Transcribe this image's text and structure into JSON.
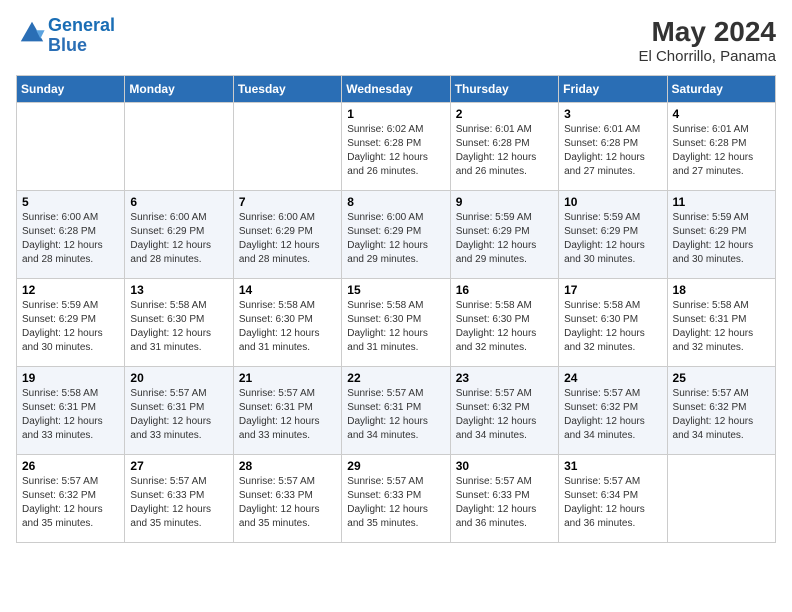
{
  "header": {
    "logo_general": "General",
    "logo_blue": "Blue",
    "month_year": "May 2024",
    "location": "El Chorrillo, Panama"
  },
  "days_of_week": [
    "Sunday",
    "Monday",
    "Tuesday",
    "Wednesday",
    "Thursday",
    "Friday",
    "Saturday"
  ],
  "weeks": [
    [
      {
        "day": "",
        "info": ""
      },
      {
        "day": "",
        "info": ""
      },
      {
        "day": "",
        "info": ""
      },
      {
        "day": "1",
        "info": "Sunrise: 6:02 AM\nSunset: 6:28 PM\nDaylight: 12 hours and 26 minutes."
      },
      {
        "day": "2",
        "info": "Sunrise: 6:01 AM\nSunset: 6:28 PM\nDaylight: 12 hours and 26 minutes."
      },
      {
        "day": "3",
        "info": "Sunrise: 6:01 AM\nSunset: 6:28 PM\nDaylight: 12 hours and 27 minutes."
      },
      {
        "day": "4",
        "info": "Sunrise: 6:01 AM\nSunset: 6:28 PM\nDaylight: 12 hours and 27 minutes."
      }
    ],
    [
      {
        "day": "5",
        "info": "Sunrise: 6:00 AM\nSunset: 6:28 PM\nDaylight: 12 hours and 28 minutes."
      },
      {
        "day": "6",
        "info": "Sunrise: 6:00 AM\nSunset: 6:29 PM\nDaylight: 12 hours and 28 minutes."
      },
      {
        "day": "7",
        "info": "Sunrise: 6:00 AM\nSunset: 6:29 PM\nDaylight: 12 hours and 28 minutes."
      },
      {
        "day": "8",
        "info": "Sunrise: 6:00 AM\nSunset: 6:29 PM\nDaylight: 12 hours and 29 minutes."
      },
      {
        "day": "9",
        "info": "Sunrise: 5:59 AM\nSunset: 6:29 PM\nDaylight: 12 hours and 29 minutes."
      },
      {
        "day": "10",
        "info": "Sunrise: 5:59 AM\nSunset: 6:29 PM\nDaylight: 12 hours and 30 minutes."
      },
      {
        "day": "11",
        "info": "Sunrise: 5:59 AM\nSunset: 6:29 PM\nDaylight: 12 hours and 30 minutes."
      }
    ],
    [
      {
        "day": "12",
        "info": "Sunrise: 5:59 AM\nSunset: 6:29 PM\nDaylight: 12 hours and 30 minutes."
      },
      {
        "day": "13",
        "info": "Sunrise: 5:58 AM\nSunset: 6:30 PM\nDaylight: 12 hours and 31 minutes."
      },
      {
        "day": "14",
        "info": "Sunrise: 5:58 AM\nSunset: 6:30 PM\nDaylight: 12 hours and 31 minutes."
      },
      {
        "day": "15",
        "info": "Sunrise: 5:58 AM\nSunset: 6:30 PM\nDaylight: 12 hours and 31 minutes."
      },
      {
        "day": "16",
        "info": "Sunrise: 5:58 AM\nSunset: 6:30 PM\nDaylight: 12 hours and 32 minutes."
      },
      {
        "day": "17",
        "info": "Sunrise: 5:58 AM\nSunset: 6:30 PM\nDaylight: 12 hours and 32 minutes."
      },
      {
        "day": "18",
        "info": "Sunrise: 5:58 AM\nSunset: 6:31 PM\nDaylight: 12 hours and 32 minutes."
      }
    ],
    [
      {
        "day": "19",
        "info": "Sunrise: 5:58 AM\nSunset: 6:31 PM\nDaylight: 12 hours and 33 minutes."
      },
      {
        "day": "20",
        "info": "Sunrise: 5:57 AM\nSunset: 6:31 PM\nDaylight: 12 hours and 33 minutes."
      },
      {
        "day": "21",
        "info": "Sunrise: 5:57 AM\nSunset: 6:31 PM\nDaylight: 12 hours and 33 minutes."
      },
      {
        "day": "22",
        "info": "Sunrise: 5:57 AM\nSunset: 6:31 PM\nDaylight: 12 hours and 34 minutes."
      },
      {
        "day": "23",
        "info": "Sunrise: 5:57 AM\nSunset: 6:32 PM\nDaylight: 12 hours and 34 minutes."
      },
      {
        "day": "24",
        "info": "Sunrise: 5:57 AM\nSunset: 6:32 PM\nDaylight: 12 hours and 34 minutes."
      },
      {
        "day": "25",
        "info": "Sunrise: 5:57 AM\nSunset: 6:32 PM\nDaylight: 12 hours and 34 minutes."
      }
    ],
    [
      {
        "day": "26",
        "info": "Sunrise: 5:57 AM\nSunset: 6:32 PM\nDaylight: 12 hours and 35 minutes."
      },
      {
        "day": "27",
        "info": "Sunrise: 5:57 AM\nSunset: 6:33 PM\nDaylight: 12 hours and 35 minutes."
      },
      {
        "day": "28",
        "info": "Sunrise: 5:57 AM\nSunset: 6:33 PM\nDaylight: 12 hours and 35 minutes."
      },
      {
        "day": "29",
        "info": "Sunrise: 5:57 AM\nSunset: 6:33 PM\nDaylight: 12 hours and 35 minutes."
      },
      {
        "day": "30",
        "info": "Sunrise: 5:57 AM\nSunset: 6:33 PM\nDaylight: 12 hours and 36 minutes."
      },
      {
        "day": "31",
        "info": "Sunrise: 5:57 AM\nSunset: 6:34 PM\nDaylight: 12 hours and 36 minutes."
      },
      {
        "day": "",
        "info": ""
      }
    ]
  ]
}
